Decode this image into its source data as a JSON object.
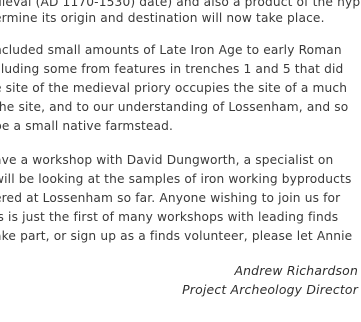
{
  "document": {
    "paragraphs": [
      [
        "dieval (AD 1170-1530) date) and also a product of the hyp",
        "ermine its origin and destination will now take place."
      ],
      [
        "ncluded small amounts of Late Iron Age to early Roman",
        "cluding some from features in trenches 1 and 5 that did",
        "e site of the medieval priory occupies the site of a much",
        "the site, and to our understanding of Lossenham, and so",
        "be a small native farmstead."
      ],
      [
        "ave a workshop with David Dungworth, a specialist on",
        "will be looking at the samples of iron working byproducts",
        "ered at Lossenham so far. Anyone wishing to join us for",
        "is is just the first of many workshops with leading finds",
        "ake part, or sign up as a finds volunteer, please let Annie"
      ]
    ],
    "signature": {
      "name": "Andrew Richardson",
      "title": "Project Archeology Director"
    }
  }
}
